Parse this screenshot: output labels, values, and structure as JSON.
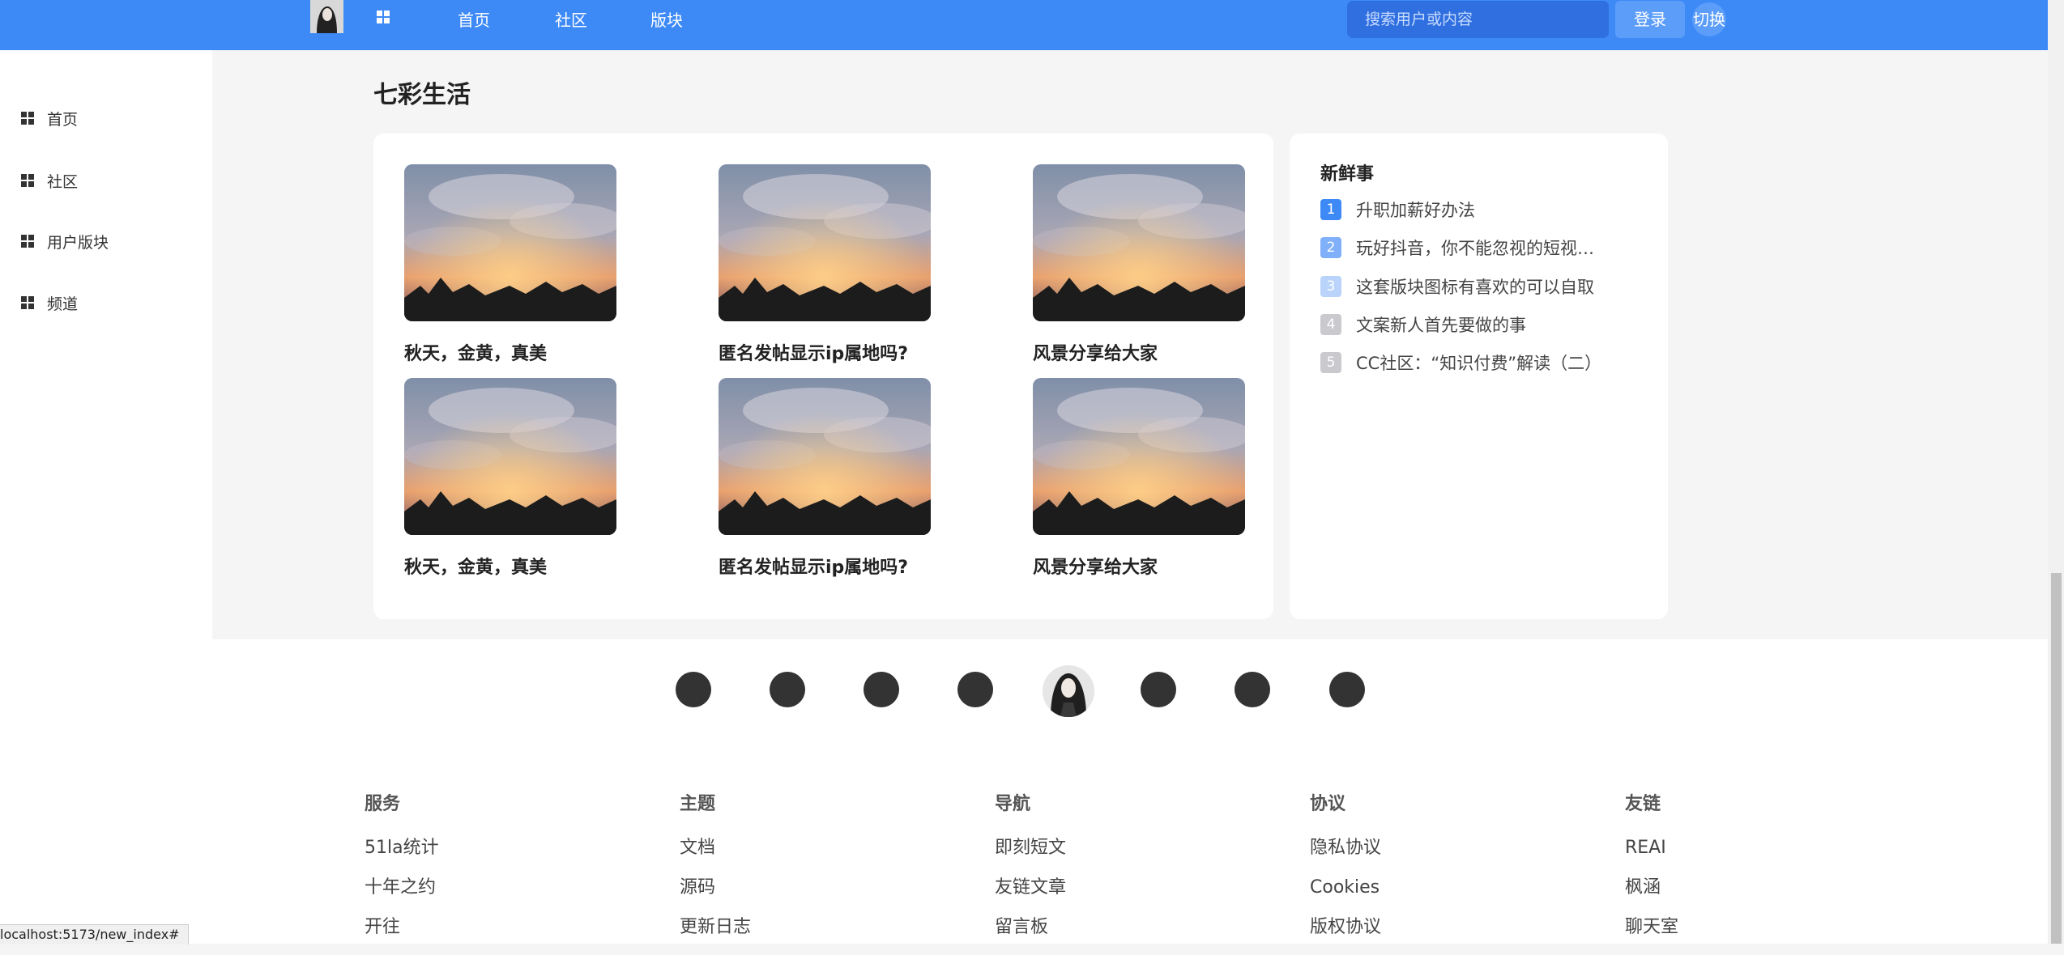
{
  "header": {
    "nav": [
      "首页",
      "社区",
      "版块"
    ],
    "search_placeholder": "搜索用户或内容",
    "login_label": "登录",
    "switch_label": "切换",
    "accent": "#3d8af7"
  },
  "sidebar": {
    "items": [
      {
        "label": "首页",
        "icon": "grid-icon"
      },
      {
        "label": "社区",
        "icon": "grid-icon"
      },
      {
        "label": "用户版块",
        "icon": "grid-icon"
      },
      {
        "label": "频道",
        "icon": "grid-icon"
      }
    ]
  },
  "section": {
    "title": "七彩生活",
    "cards": [
      {
        "caption": "秋天，金黄，真美"
      },
      {
        "caption": "匿名发帖显示ip属地吗?"
      },
      {
        "caption": "风景分享给大家"
      },
      {
        "caption": "秋天，金黄，真美"
      },
      {
        "caption": "匿名发帖显示ip属地吗?"
      },
      {
        "caption": "风景分享给大家"
      }
    ]
  },
  "news": {
    "title": "新鲜事",
    "items": [
      {
        "rank": "1",
        "text": "升职加薪好办法",
        "color": "#3d8af7"
      },
      {
        "rank": "2",
        "text": "玩好抖音，你不能忽视的短视频运营技巧",
        "color": "#7fb0f9"
      },
      {
        "rank": "3",
        "text": "这套版块图标有喜欢的可以自取",
        "color": "#b9d3fb"
      },
      {
        "rank": "4",
        "text": "文案新人首先要做的事",
        "color": "#c9c9ce"
      },
      {
        "rank": "5",
        "text": "CC社区：“知识付费”解读（二）",
        "color": "#c9c9ce"
      }
    ]
  },
  "footer": {
    "columns": [
      {
        "heading": "服务",
        "links": [
          "51la统计",
          "十年之约",
          "开往"
        ]
      },
      {
        "heading": "主题",
        "links": [
          "文档",
          "源码",
          "更新日志"
        ]
      },
      {
        "heading": "导航",
        "links": [
          "即刻短文",
          "友链文章",
          "留言板"
        ]
      },
      {
        "heading": "协议",
        "links": [
          "隐私协议",
          "Cookies",
          "版权协议"
        ]
      },
      {
        "heading": "友链",
        "links": [
          "REAI",
          "枫涵",
          "聊天室"
        ]
      }
    ]
  },
  "status_url": "localhost:5173/new_index#"
}
